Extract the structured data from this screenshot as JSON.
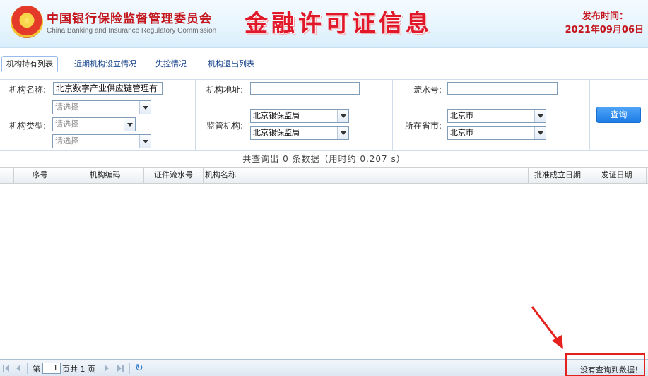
{
  "header": {
    "org_name_cn": "中国银行保险监督管理委员会",
    "org_name_en": "China Banking and Insurance Regulatory Commission",
    "title": "金融许可证信息",
    "publish_label": "发布时间：",
    "publish_date": "2021年09月06日",
    "emblem_glyph": "★"
  },
  "tabs": [
    {
      "label": "机构持有列表",
      "active": true
    },
    {
      "label": "近期机构设立情况",
      "active": false
    },
    {
      "label": "失控情况",
      "active": false
    },
    {
      "label": "机构退出列表",
      "active": false
    }
  ],
  "form": {
    "org_name_label": "机构名称:",
    "org_name_value": "北京数字产业供应链管理有",
    "org_address_label": "机构地址:",
    "org_address_value": "",
    "serial_label": "流水号:",
    "serial_value": "",
    "org_type_label": "机构类型:",
    "org_type_selects": [
      "请选择",
      "请选择",
      "请选择"
    ],
    "regulator_label": "监管机构:",
    "regulator_selects": [
      "北京银保监局",
      "北京银保监局"
    ],
    "province_label": "所在省市:",
    "province_selects": [
      "北京市",
      "北京市"
    ],
    "query_button": "查询"
  },
  "summary": "共查询出 0 条数据（用时约 0.207 s）",
  "grid": {
    "columns": [
      "序号",
      "机构编码",
      "证件流水号",
      "机构名称",
      "批准成立日期",
      "发证日期"
    ],
    "rows": []
  },
  "pager": {
    "page_prefix": "第",
    "page_value": "1",
    "page_suffix": "页共 1 页",
    "status": "没有查询到数据！"
  },
  "colors": {
    "title_red": "#e0182a",
    "link_blue": "#15428b",
    "button_blue": "#1d7ce6",
    "highlight_red": "#e5211d"
  }
}
